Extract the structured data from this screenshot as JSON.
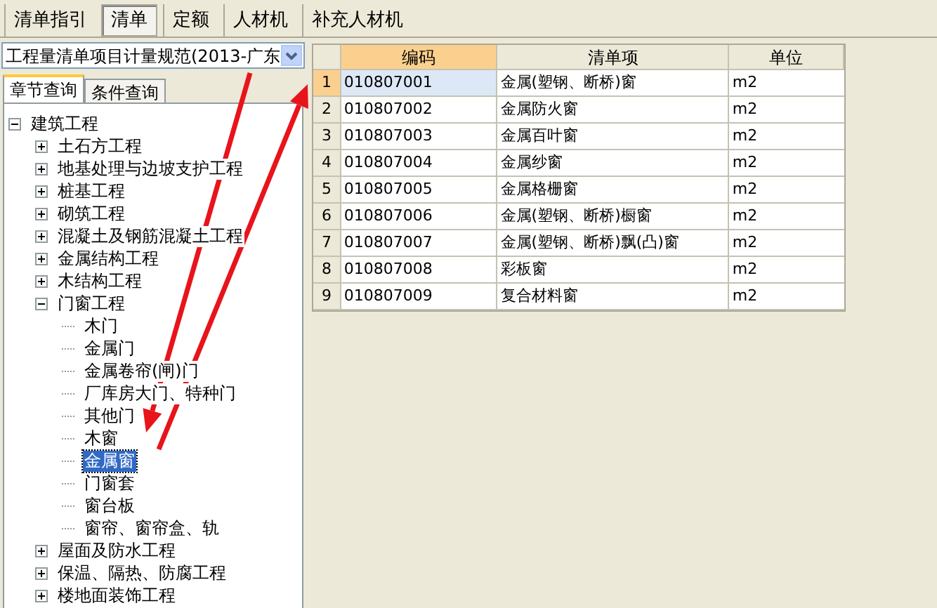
{
  "tabs": [
    {
      "label": "清单指引",
      "selected": false
    },
    {
      "label": "清单",
      "selected": true
    },
    {
      "label": "定额",
      "selected": false
    },
    {
      "label": "人材机",
      "selected": false
    },
    {
      "label": "补充人材机",
      "selected": false
    }
  ],
  "standard_dropdown": {
    "value": "工程量清单项目计量规范(2013-广东"
  },
  "query_tabs": [
    {
      "label": "章节查询",
      "selected": true
    },
    {
      "label": "条件查询",
      "selected": false
    }
  ],
  "tree": [
    {
      "label": "建筑工程",
      "expanded": true,
      "selected": false,
      "children": [
        {
          "label": "土石方工程",
          "expanded": false,
          "selected": false
        },
        {
          "label": "地基处理与边坡支护工程",
          "expanded": false,
          "selected": false
        },
        {
          "label": "桩基工程",
          "expanded": false,
          "selected": false
        },
        {
          "label": "砌筑工程",
          "expanded": false,
          "selected": false
        },
        {
          "label": "混凝土及钢筋混凝土工程",
          "expanded": false,
          "selected": false
        },
        {
          "label": "金属结构工程",
          "expanded": false,
          "selected": false
        },
        {
          "label": "木结构工程",
          "expanded": false,
          "selected": false
        },
        {
          "label": "门窗工程",
          "expanded": true,
          "selected": false,
          "children": [
            {
              "label": "木门",
              "selected": false
            },
            {
              "label": "金属门",
              "selected": false
            },
            {
              "label": "金属卷帘(闸)门",
              "selected": false
            },
            {
              "label": "厂库房大门、特种门",
              "selected": false
            },
            {
              "label": "其他门",
              "selected": false
            },
            {
              "label": "木窗",
              "selected": false
            },
            {
              "label": "金属窗",
              "selected": true
            },
            {
              "label": "门窗套",
              "selected": false
            },
            {
              "label": "窗台板",
              "selected": false
            },
            {
              "label": "窗帘、窗帘盒、轨",
              "selected": false
            }
          ]
        },
        {
          "label": "屋面及防水工程",
          "expanded": false,
          "selected": false
        },
        {
          "label": "保温、隔热、防腐工程",
          "expanded": false,
          "selected": false
        },
        {
          "label": "楼地面装饰工程",
          "expanded": false,
          "selected": false
        }
      ]
    }
  ],
  "table": {
    "columns": [
      {
        "label": "编码",
        "selected": true
      },
      {
        "label": "清单项",
        "selected": false
      },
      {
        "label": "单位",
        "selected": false
      }
    ],
    "rows": [
      {
        "number": "1",
        "code": "010807001",
        "item": "金属(塑钢、断桥)窗",
        "unit": "m2",
        "selected": true
      },
      {
        "number": "2",
        "code": "010807002",
        "item": "金属防火窗",
        "unit": "m2",
        "selected": false
      },
      {
        "number": "3",
        "code": "010807003",
        "item": "金属百叶窗",
        "unit": "m2",
        "selected": false
      },
      {
        "number": "4",
        "code": "010807004",
        "item": "金属纱窗",
        "unit": "m2",
        "selected": false
      },
      {
        "number": "5",
        "code": "010807005",
        "item": "金属格栅窗",
        "unit": "m2",
        "selected": false
      },
      {
        "number": "6",
        "code": "010807006",
        "item": "金属(塑钢、断桥)橱窗",
        "unit": "m2",
        "selected": false
      },
      {
        "number": "7",
        "code": "010807007",
        "item": "金属(塑钢、断桥)飘(凸)窗",
        "unit": "m2",
        "selected": false
      },
      {
        "number": "8",
        "code": "010807008",
        "item": "彩板窗",
        "unit": "m2",
        "selected": false
      },
      {
        "number": "9",
        "code": "010807009",
        "item": "复合材料窗",
        "unit": "m2",
        "selected": false
      }
    ]
  }
}
